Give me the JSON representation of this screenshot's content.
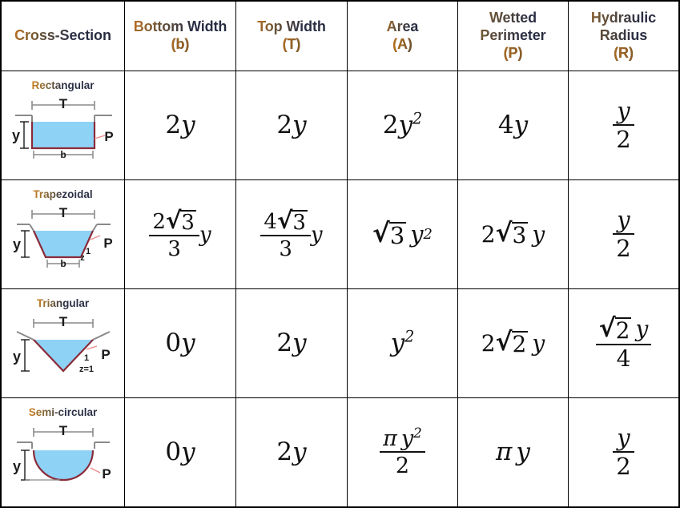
{
  "table": {
    "headers": [
      {
        "label": "Cross-Section",
        "symbol": ""
      },
      {
        "label": "Bottom Width",
        "symbol": "(b)"
      },
      {
        "label": "Top Width",
        "symbol": "(T)"
      },
      {
        "label": "Area",
        "symbol": "(A)"
      },
      {
        "label": "Wetted Perimeter",
        "symbol": "(P)"
      },
      {
        "label": "Hydraulic Radius",
        "symbol": "(R)"
      }
    ],
    "rows": [
      {
        "name": "Rectangular",
        "diagram_labels": {
          "top": "T",
          "depth": "y",
          "bottom": "b",
          "perimeter": "P",
          "slope_run": "",
          "slope_rise": ""
        },
        "bottom_width": {
          "coef": "2",
          "var": "y"
        },
        "top_width": {
          "coef": "2",
          "var": "y"
        },
        "area": {
          "coef": "2",
          "var": "y",
          "exp": "2"
        },
        "wetted_perimeter": {
          "coef": "4",
          "var": "y"
        },
        "hydraulic_radius": {
          "num": "y",
          "den": "2"
        }
      },
      {
        "name": "Trapezoidal",
        "diagram_labels": {
          "top": "T",
          "depth": "y",
          "bottom": "b",
          "perimeter": "P",
          "slope_run": "z",
          "slope_rise": "1"
        },
        "bottom_width": {
          "num_coef": "2",
          "root": "3",
          "den": "3",
          "var": "y"
        },
        "top_width": {
          "num_coef": "4",
          "root": "3",
          "den": "3",
          "var": "y"
        },
        "area": {
          "root": "3",
          "var": "y",
          "exp": "2"
        },
        "wetted_perimeter": {
          "coef": "2",
          "root": "3",
          "var": "y"
        },
        "hydraulic_radius": {
          "num": "y",
          "den": "2"
        }
      },
      {
        "name": "Triangular",
        "diagram_labels": {
          "top": "T",
          "depth": "y",
          "bottom": "",
          "perimeter": "P",
          "slope_run": "z=1",
          "slope_rise": "1"
        },
        "bottom_width": {
          "coef": "0",
          "var": "y"
        },
        "top_width": {
          "coef": "2",
          "var": "y"
        },
        "area": {
          "var": "y",
          "exp": "2"
        },
        "wetted_perimeter": {
          "coef": "2",
          "root": "2",
          "var": "y"
        },
        "hydraulic_radius": {
          "num_root": "2",
          "num_var": "y",
          "den": "4"
        }
      },
      {
        "name": "Semi-circular",
        "diagram_labels": {
          "top": "T",
          "depth": "y",
          "bottom": "",
          "perimeter": "P",
          "slope_run": "",
          "slope_rise": ""
        },
        "bottom_width": {
          "coef": "0",
          "var": "y"
        },
        "top_width": {
          "coef": "2",
          "var": "y"
        },
        "area": {
          "num_sym": "π",
          "num_var": "y",
          "exp": "2",
          "den": "2"
        },
        "wetted_perimeter": {
          "sym": "π",
          "var": "y"
        },
        "hydraulic_radius": {
          "num": "y",
          "den": "2"
        }
      }
    ]
  },
  "colors": {
    "water_fill": "#8ed2f5",
    "perimeter_line": "#8b2b3a",
    "channel_wall": "#8a8a8a",
    "dimension_line": "#8a8a8a",
    "leader_line": "#f08a8a",
    "border": "#000000",
    "header_text": "#2b2f45",
    "header_symbol": "#c8741f"
  }
}
